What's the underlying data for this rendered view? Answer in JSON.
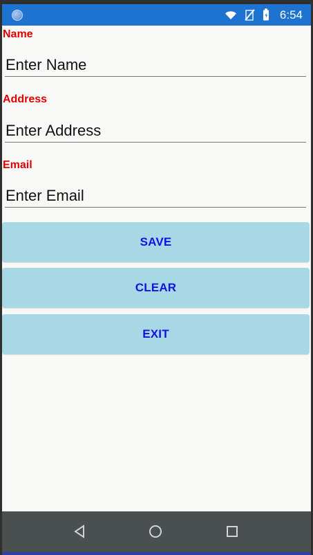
{
  "status_bar": {
    "time": "6:54",
    "icons": [
      "status-dot-icon",
      "wifi-icon",
      "no-signal-icon",
      "battery-icon"
    ],
    "color": "#1e73d0"
  },
  "form": {
    "name_label": "Name",
    "name_placeholder": "Enter Name",
    "address_label": "Address",
    "address_placeholder": "Enter Address",
    "email_label": "Email",
    "email_placeholder": "Enter Email",
    "label_color": "#e00000"
  },
  "buttons": {
    "save": "SAVE",
    "clear": "CLEAR",
    "exit": "EXIT",
    "background": "#a8d8e6",
    "text_color": "#1111e0"
  },
  "navigation": {
    "icons": [
      "back-icon",
      "home-icon",
      "recents-icon"
    ],
    "background": "#4a4f4f"
  }
}
